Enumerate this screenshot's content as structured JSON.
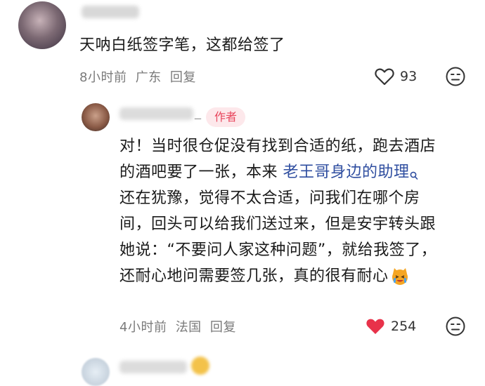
{
  "comment1": {
    "text": "天呐白纸签字笔，这都给签了",
    "time": "8小时前",
    "location": "广东",
    "reply_label": "回复",
    "like_count": "93"
  },
  "reply": {
    "author_badge": "作者",
    "name_suffix": "_",
    "text_line1": "对！当时很仓促没有找到合适的纸，跑去酒店",
    "text_line2_pre": "的酒吧要了一张，本来 ",
    "text_line2_link": "老王哥身边的助理",
    "text_line3": "还在犹豫，觉得不太合适，问我们在哪个房",
    "text_line4": "间，回头可以给我们送过来，但是安宇转头跟",
    "text_line5": "她说：“不要问人家这种问题”，就给我签了，",
    "text_line6": "还耐心地问需要签几张，真的很有耐心",
    "time": "4小时前",
    "location": "法国",
    "reply_label": "回复",
    "like_count": "254"
  },
  "colors": {
    "like_active": "#e8324a",
    "badge_bg": "#fde8eb",
    "badge_text": "#e8465d",
    "link": "#2f4ea0",
    "meta": "#7a7a7a"
  },
  "icons": {
    "like_outline": "heart-outline-icon",
    "like_filled": "heart-filled-icon",
    "dislike": "dislike-face-icon",
    "search_link": "search-icon",
    "emoji": "cat-crying-emoji-icon"
  }
}
